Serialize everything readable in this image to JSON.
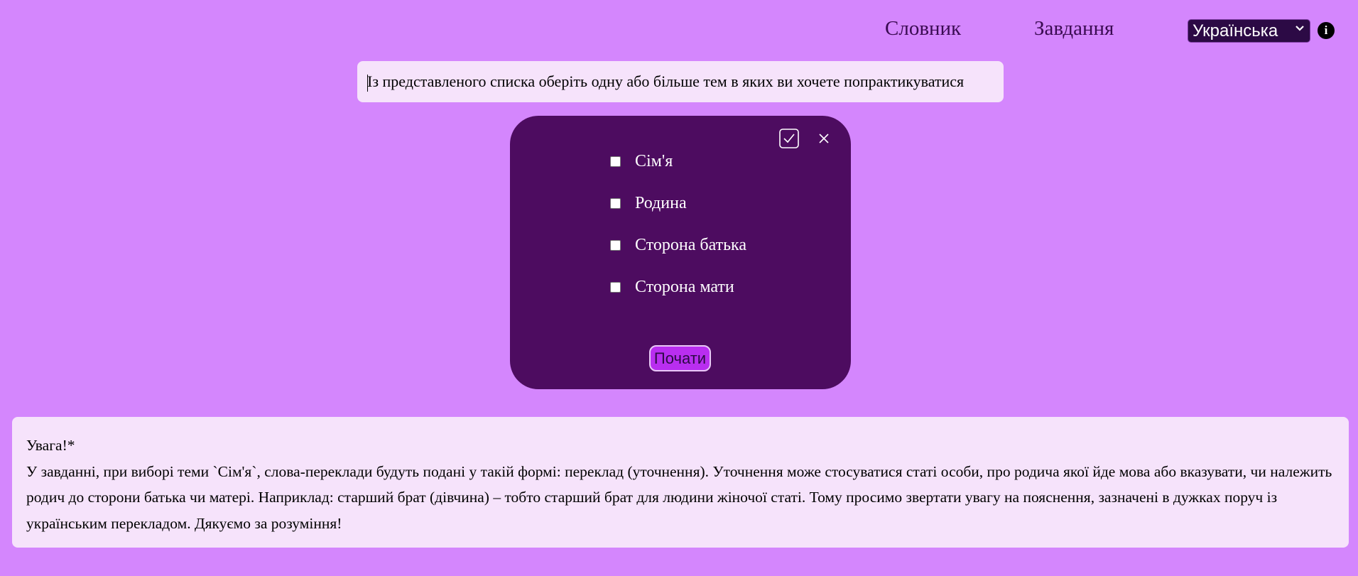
{
  "nav": {
    "dictionary": "Словник",
    "tasks": "Завдання",
    "language": "Українська",
    "language_chevron": "chevron-down-icon",
    "info_icon": "info-icon"
  },
  "instruction": "Із представленого списка оберіть одну або більше тем в яких ви хочете попрактикуватися",
  "panel": {
    "confirm_icon": "checkbox-check-icon",
    "close_icon": "close-icon",
    "topics": [
      {
        "label": "Сім'я",
        "checked": false
      },
      {
        "label": "Родина",
        "checked": false
      },
      {
        "label": "Сторона батька",
        "checked": false
      },
      {
        "label": "Сторона мати",
        "checked": false
      }
    ],
    "start_label": "Почати"
  },
  "notice": {
    "title": "Увага!*",
    "body": "У завданні, при виборі теми `Сім'я`, слова-переклади будуть подані у такій формі: переклад (уточнення). Уточнення може стосуватися статі особи, про родича якої йде мова або вказувати, чи належить родич до сторони батька чи матері. Наприклад: старший брат (дівчина) – тобто старший брат для людини жіночої статі. Тому просимо звертати увагу на пояснення, зазначені в дужках поруч із українським перекладом. Дякуємо за розуміння!"
  },
  "colors": {
    "background": "#d486fd",
    "panel": "#4d0c60",
    "card": "#f6e3fb",
    "button": "#b92ef0"
  }
}
